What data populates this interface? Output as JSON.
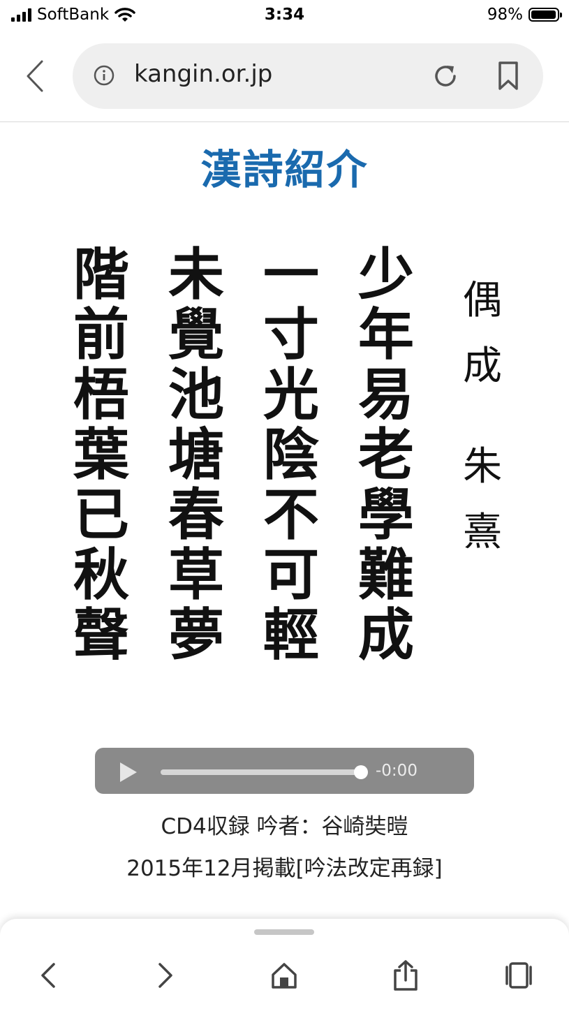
{
  "status_bar": {
    "carrier": "SoftBank",
    "time": "3:34",
    "battery": "98%",
    "battery_level": 0.98
  },
  "browser": {
    "url": "kangin.or.jp"
  },
  "page": {
    "title": "漢詩紹介",
    "title_color": "#1a6aae",
    "poem_columns": [
      [
        "偶",
        "成",
        "朱",
        "熹"
      ],
      [
        "少",
        "年",
        "易",
        "老",
        "學",
        "難",
        "成"
      ],
      [
        "一",
        "寸",
        "光",
        "陰",
        "不",
        "可",
        "輕"
      ],
      [
        "未",
        "覺",
        "池",
        "塘",
        "春",
        "草",
        "夢"
      ],
      [
        "階",
        "前",
        "梧",
        "葉",
        "已",
        "秋",
        "聲"
      ]
    ],
    "audio": {
      "time_remaining": "-0:00",
      "progress": 1.0
    },
    "caption_line1": "CD4収録 吟者：谷崎奘暟",
    "caption_line2": "2015年12月掲載[吟法改定再録]"
  }
}
